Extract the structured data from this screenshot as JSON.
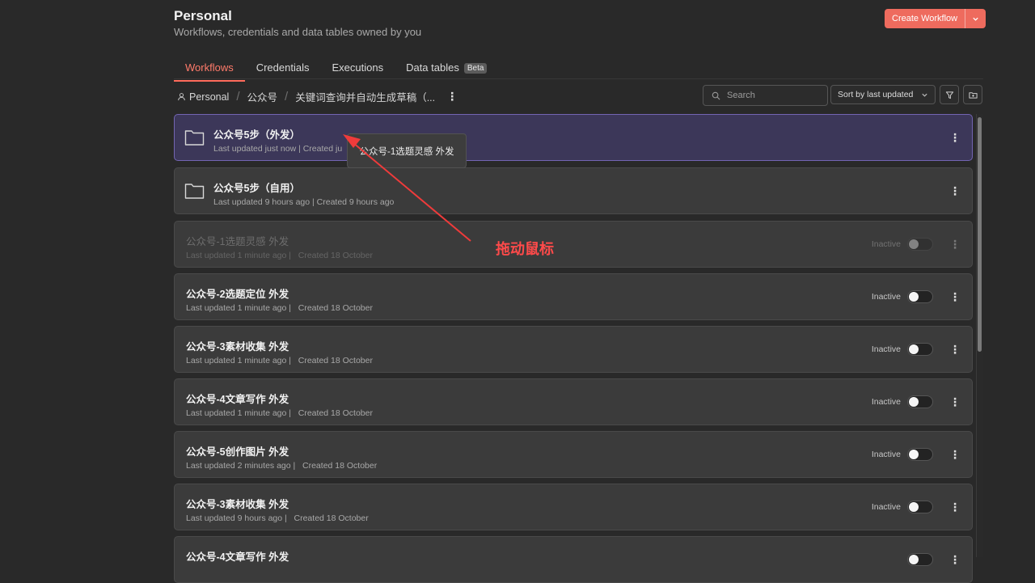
{
  "header": {
    "title": "Personal",
    "subtitle": "Workflows, credentials and data tables owned by you",
    "create_button": "Create Workflow"
  },
  "tabs": [
    {
      "label": "Workflows",
      "active": true
    },
    {
      "label": "Credentials"
    },
    {
      "label": "Executions"
    },
    {
      "label": "Data tables",
      "badge": "Beta"
    }
  ],
  "breadcrumb": {
    "root": "Personal",
    "folder": "公众号",
    "current": "关键词查询并自动生成草稿（..."
  },
  "toolbar": {
    "search_placeholder": "Search",
    "sort_label": "Sort by last updated"
  },
  "folders": [
    {
      "name": "公众号5步（外发）",
      "meta": "Last updated just now | Created ju"
    },
    {
      "name": "公众号5步（自用）",
      "meta": "Last updated 9 hours ago | Created 9 hours ago"
    }
  ],
  "workflows": [
    {
      "name": "公众号-1选题灵感 外发",
      "updated": "Last updated 1 minute ago |",
      "created": "Created 18 October",
      "status": "Inactive"
    },
    {
      "name": "公众号-2选题定位 外发",
      "updated": "Last updated 1 minute ago |",
      "created": "Created 18 October",
      "status": "Inactive"
    },
    {
      "name": "公众号-3素材收集 外发",
      "updated": "Last updated 1 minute ago |",
      "created": "Created 18 October",
      "status": "Inactive"
    },
    {
      "name": "公众号-4文章写作 外发",
      "updated": "Last updated 1 minute ago |",
      "created": "Created 18 October",
      "status": "Inactive"
    },
    {
      "name": "公众号-5创作图片 外发",
      "updated": "Last updated 2 minutes ago |",
      "created": "Created 18 October",
      "status": "Inactive"
    },
    {
      "name": "公众号-3素材收集 外发",
      "updated": "Last updated 9 hours ago |",
      "created": "Created 18 October",
      "status": "Inactive"
    },
    {
      "name": "公众号-4文章写作 外发",
      "updated": "",
      "created": "",
      "status": ""
    }
  ],
  "drag_tooltip": "公众号-1选题灵感 外发",
  "annotation": "拖动鼠标",
  "colors": {
    "accent": "#ee6b5e",
    "annotation": "#ff4a4a",
    "drop_target": "#7365b3"
  }
}
